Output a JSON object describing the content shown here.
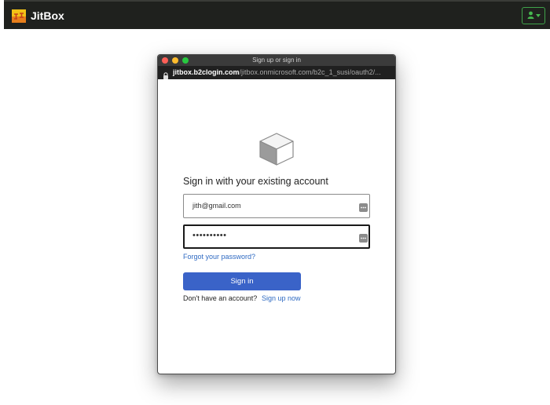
{
  "app": {
    "brand_name": "JitBox"
  },
  "popup": {
    "window_title": "Sign up or sign in",
    "url_domain": "jitbox.b2clogin.com",
    "url_path": "/jitbox.onmicrosoft.com/b2c_1_susi/oauth2/..."
  },
  "signin": {
    "heading": "Sign in with your existing account",
    "email_value": "jith@gmail.com",
    "password_value": "••••••••••",
    "forgot_label": "Forgot your password?",
    "submit_label": "Sign in",
    "no_account_text": "Don't have an account?",
    "signup_label": "Sign up now"
  },
  "icons": {
    "logo": "jitbox-logo-icon",
    "user": "user-icon",
    "dropdown": "caret-down-icon",
    "lock": "lock-icon",
    "cube": "cube-icon",
    "autofill": "keyboard-icon"
  },
  "colors": {
    "navbar_bg": "#1f211e",
    "user_button_accent": "#46b74f",
    "primary_button": "#3a63c8",
    "link": "#2f6ac2"
  }
}
